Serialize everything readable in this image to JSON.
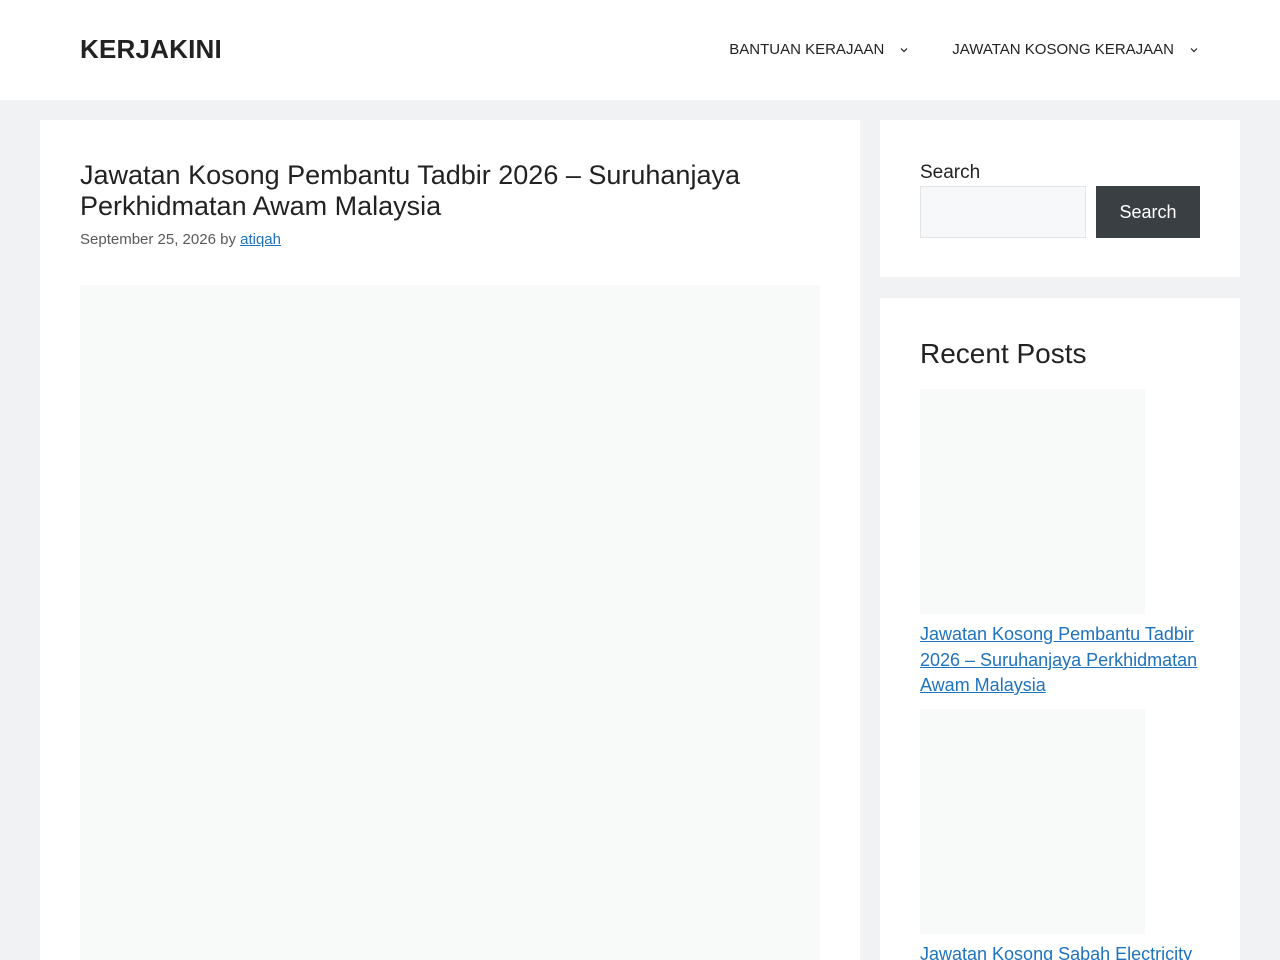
{
  "header": {
    "site_title": "KERJAKINI",
    "nav": [
      {
        "label": "BANTUAN KERAJAAN",
        "icon": "chevron-down-icon"
      },
      {
        "label": "JAWATAN KOSONG KERAJAAN",
        "icon": "chevron-down-icon"
      }
    ]
  },
  "article": {
    "title": "Jawatan Kosong Pembantu Tadbir 2026 – Suruhanjaya Perkhidmatan Awam Malaysia",
    "date": "September 25, 2026",
    "by": "by",
    "author": "atiqah"
  },
  "sidebar": {
    "search": {
      "label": "Search",
      "placeholder": "",
      "button_label": "Search"
    },
    "recent_posts": {
      "title": "Recent Posts",
      "items": [
        {
          "title": "Jawatan Kosong Pembantu Tadbir 2026 – Suruhanjaya Perkhidmatan Awam Malaysia"
        },
        {
          "title": "Jawatan Kosong Sabah Electricity"
        }
      ]
    }
  },
  "colors": {
    "background": "#f0f2f3",
    "link": "#1e73be",
    "button": "#3a3f44"
  }
}
